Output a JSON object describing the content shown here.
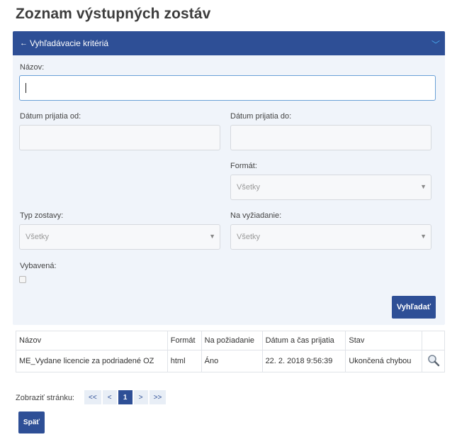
{
  "page": {
    "title": "Zoznam výstupných zostáv"
  },
  "filters": {
    "header": "Vyhľadávacie kritériá",
    "name_label": "Názov:",
    "name_value": "",
    "date_from_label": "Dátum prijatia od:",
    "date_from_value": "",
    "date_to_label": "Dátum prijatia do:",
    "date_to_value": "",
    "format_label": "Formát:",
    "format_value": "Všetky",
    "report_type_label": "Typ zostavy:",
    "report_type_value": "Všetky",
    "on_request_label": "Na vyžiadanie:",
    "on_request_value": "Všetky",
    "done_label": "Vybavená:",
    "done_checked": false,
    "search_button": "Vyhľadať"
  },
  "table": {
    "columns": [
      "Názov",
      "Formát",
      "Na požiadanie",
      "Dátum a čas prijatia",
      "Stav"
    ],
    "rows": [
      {
        "name": "ME_Vydane licencie za podriadené OZ",
        "format": "html",
        "on_request": "Áno",
        "received": "22. 2. 2018 9:56:39",
        "status": "Ukončená chybou"
      }
    ]
  },
  "pagination": {
    "label": "Zobraziť stránku:",
    "first": "<<",
    "prev": "<",
    "current": "1",
    "next": ">",
    "last": ">>"
  },
  "footer": {
    "back_button": "Späť"
  },
  "colors": {
    "primary": "#2e4f96",
    "panel_bg": "#f0f4fa",
    "accent": "#49a8ee"
  }
}
